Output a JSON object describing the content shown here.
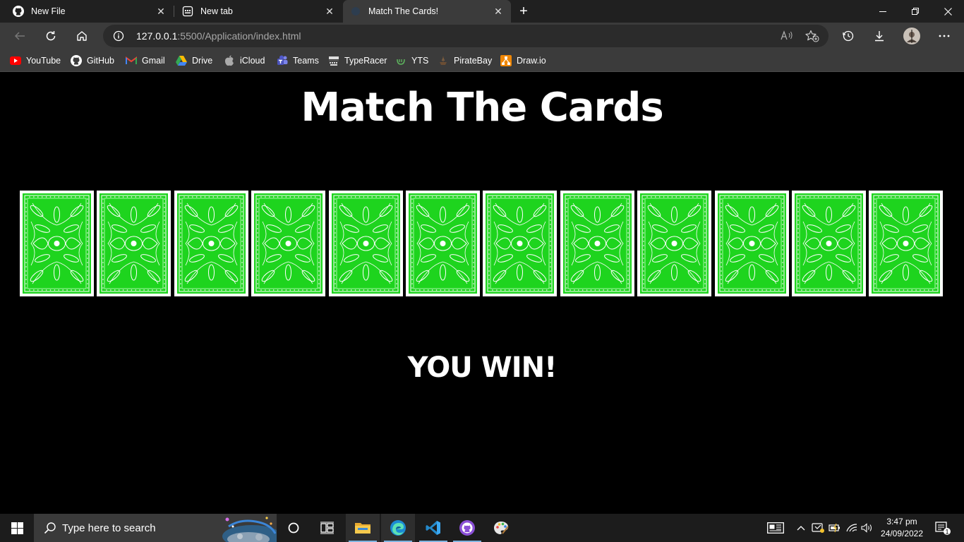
{
  "browser": {
    "tabs": [
      {
        "title": "New File",
        "icon": "github-icon",
        "active": false
      },
      {
        "title": "New tab",
        "icon": "new-tab-page-icon",
        "active": false
      },
      {
        "title": "Match The Cards!",
        "icon": "page-icon",
        "active": true
      }
    ],
    "close_glyph": "✕",
    "new_tab_glyph": "+",
    "url": {
      "host": "127.0.0.1",
      "rest": ":5500/Application/index.html"
    },
    "bookmarks": [
      {
        "label": "YouTube",
        "icon": "youtube-icon"
      },
      {
        "label": "GitHub",
        "icon": "github-icon"
      },
      {
        "label": "Gmail",
        "icon": "gmail-icon"
      },
      {
        "label": "Drive",
        "icon": "drive-icon"
      },
      {
        "label": "iCloud",
        "icon": "apple-icon"
      },
      {
        "label": "Teams",
        "icon": "teams-icon"
      },
      {
        "label": "TypeRacer",
        "icon": "typeracer-icon"
      },
      {
        "label": "YTS",
        "icon": "yts-icon"
      },
      {
        "label": "PirateBay",
        "icon": "piratebay-icon"
      },
      {
        "label": "Draw.io",
        "icon": "drawio-icon"
      }
    ]
  },
  "page": {
    "title": "Match The Cards",
    "card_count": 12,
    "card_color": "#1ed41e",
    "result_text": "YOU WIN!"
  },
  "taskbar": {
    "search_placeholder": "Type here to search",
    "time": "3:47 pm",
    "date": "24/09/2022",
    "notification_count": "1"
  }
}
